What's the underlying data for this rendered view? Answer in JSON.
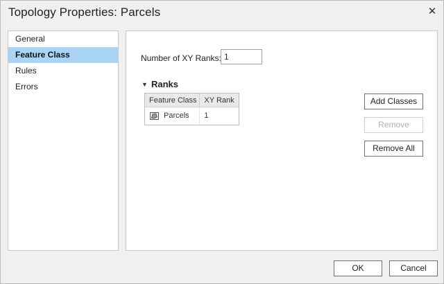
{
  "window": {
    "title": "Topology Properties: Parcels",
    "close_glyph": "✕"
  },
  "nav": {
    "items": [
      {
        "label": "General",
        "selected": false
      },
      {
        "label": "Feature Class",
        "selected": true
      },
      {
        "label": "Rules",
        "selected": false
      },
      {
        "label": "Errors",
        "selected": false
      }
    ]
  },
  "content": {
    "xy_ranks_label": "Number of XY Ranks:",
    "xy_ranks_value": "1",
    "ranks_heading": "Ranks",
    "table": {
      "headers": [
        "Feature Class",
        "XY Rank"
      ],
      "rows": [
        {
          "feature_class": "Parcels",
          "xy_rank": "1"
        }
      ]
    },
    "buttons": {
      "add_classes": "Add Classes",
      "remove": "Remove",
      "remove_all": "Remove All"
    }
  },
  "footer": {
    "ok": "OK",
    "cancel": "Cancel"
  }
}
